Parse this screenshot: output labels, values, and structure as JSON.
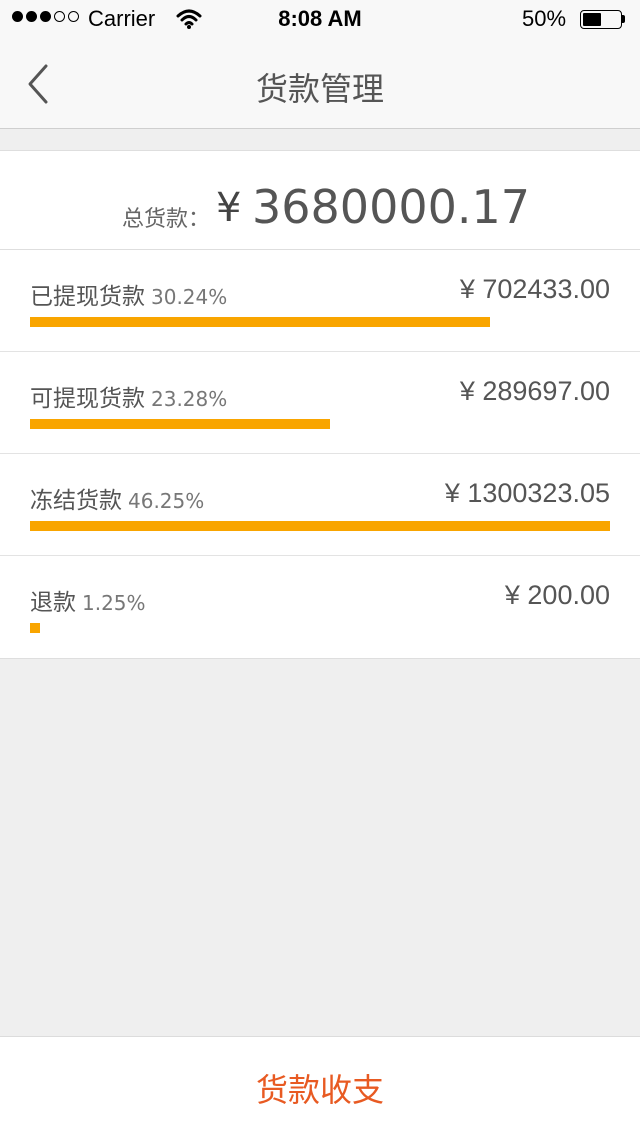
{
  "status_bar": {
    "carrier": "Carrier",
    "time": "8:08 AM",
    "battery": "50%",
    "battery_level": 0.5
  },
  "nav": {
    "title": "货款管理"
  },
  "summary": {
    "label": "总货款：",
    "currency": "¥",
    "amount": "3680000.17"
  },
  "breakdown": [
    {
      "label": "已提现货款",
      "percent": "30.24%",
      "amount": "¥ 702433.00",
      "fraction": 0.7931
    },
    {
      "label": "可提现货款",
      "percent": "23.28%",
      "amount": "¥ 289697.00",
      "fraction": 0.5172
    },
    {
      "label": "冻结货款",
      "percent": "46.25%",
      "amount": "¥ 1300323.05",
      "fraction": 1.0
    },
    {
      "label": "退款",
      "percent": "1.25%",
      "amount": "¥ 200.00",
      "fraction": 0.0172
    }
  ],
  "footer": {
    "button_label": "货款收支"
  },
  "colors": {
    "bar": "#f9a500",
    "accent": "#e85a22"
  }
}
